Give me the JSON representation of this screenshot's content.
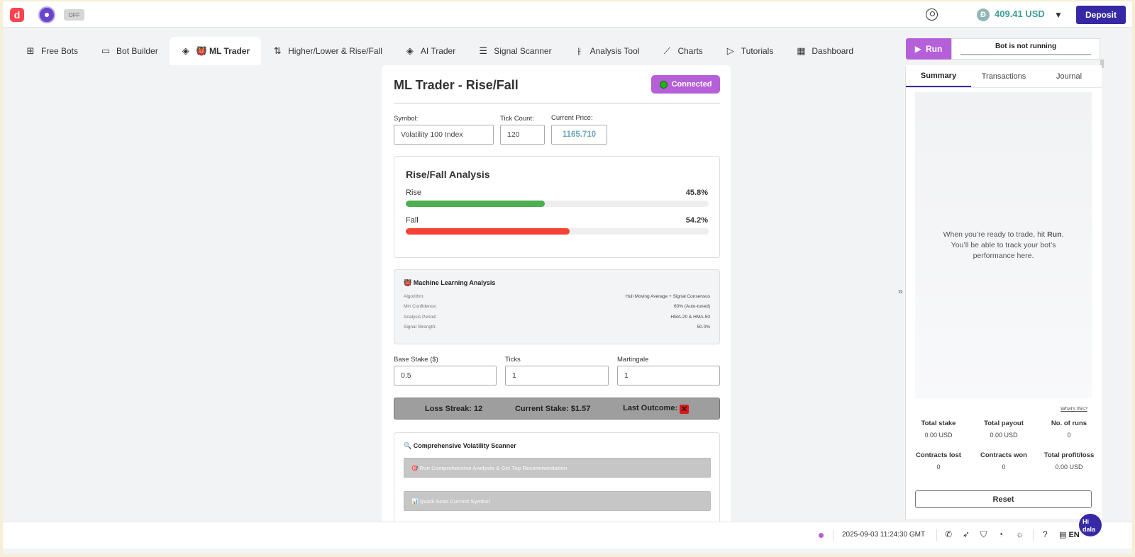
{
  "header": {
    "logo": "d",
    "off_badge": "OFF",
    "currency_symbol": "Đ",
    "balance": "409.41 USD",
    "deposit_label": "Deposit"
  },
  "tabs": [
    {
      "label": "Free Bots",
      "icon": "grid-plus-icon"
    },
    {
      "label": "Bot Builder",
      "icon": "builder-icon"
    },
    {
      "label": "👹 ML Trader",
      "icon": "layers-icon",
      "active": true
    },
    {
      "label": "Higher/Lower & Rise/Fall",
      "icon": "arrows-updown-icon"
    },
    {
      "label": "AI Trader",
      "icon": "layers-icon"
    },
    {
      "label": "Signal Scanner",
      "icon": "list-icon"
    },
    {
      "label": "Analysis Tool",
      "icon": "candles-icon"
    },
    {
      "label": "Charts",
      "icon": "chart-line-icon"
    },
    {
      "label": "Tutorials",
      "icon": "play-icon"
    },
    {
      "label": "Dashboard",
      "icon": "dashboard-icon"
    }
  ],
  "trader": {
    "title": "ML Trader - Rise/Fall",
    "status": "Connected",
    "symbol_label": "Symbol:",
    "symbol_value": "Volatility 100 Index",
    "tick_count_label": "Tick Count:",
    "tick_count_value": "120",
    "current_price_label": "Current Price:",
    "current_price_value": "1165.710"
  },
  "analysis": {
    "title": "Rise/Fall Analysis",
    "rise_label": "Rise",
    "rise_value": "45.8%",
    "rise_fraction": 0.458,
    "fall_label": "Fall",
    "fall_value": "54.2%",
    "fall_fraction": 0.542,
    "rise_color": "#4caf50",
    "fall_color": "#f44336"
  },
  "ml": {
    "title": "👹 Machine Learning Analysis",
    "rows": [
      {
        "label": "Algorithm:",
        "value": "Hull Moving Average + Signal Consensus"
      },
      {
        "label": "Min Confidence:",
        "value": "60% (Auto-tuned)"
      },
      {
        "label": "Analysis Period:",
        "value": "HMA-20 & HMA-50"
      },
      {
        "label": "Signal Strength:",
        "value": "50.0%"
      }
    ]
  },
  "settings": {
    "base_stake_label": "Base Stake ($)",
    "base_stake_value": "0.5",
    "ticks_label": "Ticks",
    "ticks_value": "1",
    "martingale_label": "Martingale",
    "martingale_value": "1"
  },
  "streak": {
    "loss_streak": "Loss Streak: 12",
    "current_stake": "Current Stake: $1.57",
    "last_outcome": "Last Outcome:",
    "last_outcome_mark": "✕"
  },
  "scanner": {
    "title": "🔍 Comprehensive Volatility Scanner",
    "run_button": "🎯 Run Comprehensive Analysis & Get Top Recommendation",
    "quick_button": "📊 Quick Scan Current Symbol"
  },
  "run_panel": {
    "run_label": "Run",
    "status": "Bot is not running",
    "tabs": [
      "Summary",
      "Transactions",
      "Journal"
    ],
    "empty_line1": "When you’re ready to trade, hit ",
    "empty_bold": "Run",
    "empty_line2": ". You’ll be able to track your bot’s performance here.",
    "whats_this": "What's this?",
    "stats": [
      {
        "label": "Total stake",
        "value": "0.00 USD"
      },
      {
        "label": "Total payout",
        "value": "0.00 USD"
      },
      {
        "label": "No. of runs",
        "value": "0"
      },
      {
        "label": "Contracts lost",
        "value": "0"
      },
      {
        "label": "Contracts won",
        "value": "0"
      },
      {
        "label": "Total profit/loss",
        "value": "0.00 USD"
      }
    ],
    "reset_label": "Reset"
  },
  "footer": {
    "timestamp": "2025-09-03 11:24:30 GMT",
    "language": "EN",
    "chat_label": "Hi dala"
  }
}
